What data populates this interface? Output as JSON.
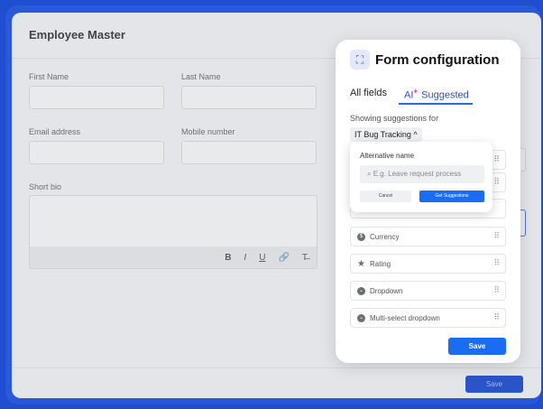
{
  "background_form": {
    "title": "Employee Master",
    "labels": {
      "first_name": "First Name",
      "last_name": "Last Name",
      "email": "Email address",
      "mobile": "Mobile number",
      "short_bio": "Short bio"
    },
    "toolbar": [
      "B",
      "I",
      "U",
      "🔗",
      "T̶"
    ],
    "save_label": "Save"
  },
  "modal": {
    "title": "Form configuration",
    "icon": "grid-icon",
    "tabs": [
      {
        "label": "All fields"
      },
      {
        "label": "Suggested",
        "prefix": "AI"
      }
    ],
    "showing_label": "Showing suggestions for",
    "selected_category": "IT Bug Tracking",
    "fields": [
      {
        "label": "Currency",
        "icon": "currency-icon"
      },
      {
        "label": "Rating",
        "icon": "star-icon"
      },
      {
        "label": "Dropdown",
        "icon": "dropdown-icon"
      },
      {
        "label": "Multi-select dropdown",
        "icon": "multiselect-icon"
      }
    ],
    "save_label": "Save"
  },
  "popover": {
    "label": "Alternative name",
    "placeholder": "E.g. Leave request process",
    "cancel_label": "Cancel",
    "get_label": "Get Suggestions"
  },
  "colors": {
    "accent": "#1a6df0",
    "frame": "#1f4fd1"
  }
}
